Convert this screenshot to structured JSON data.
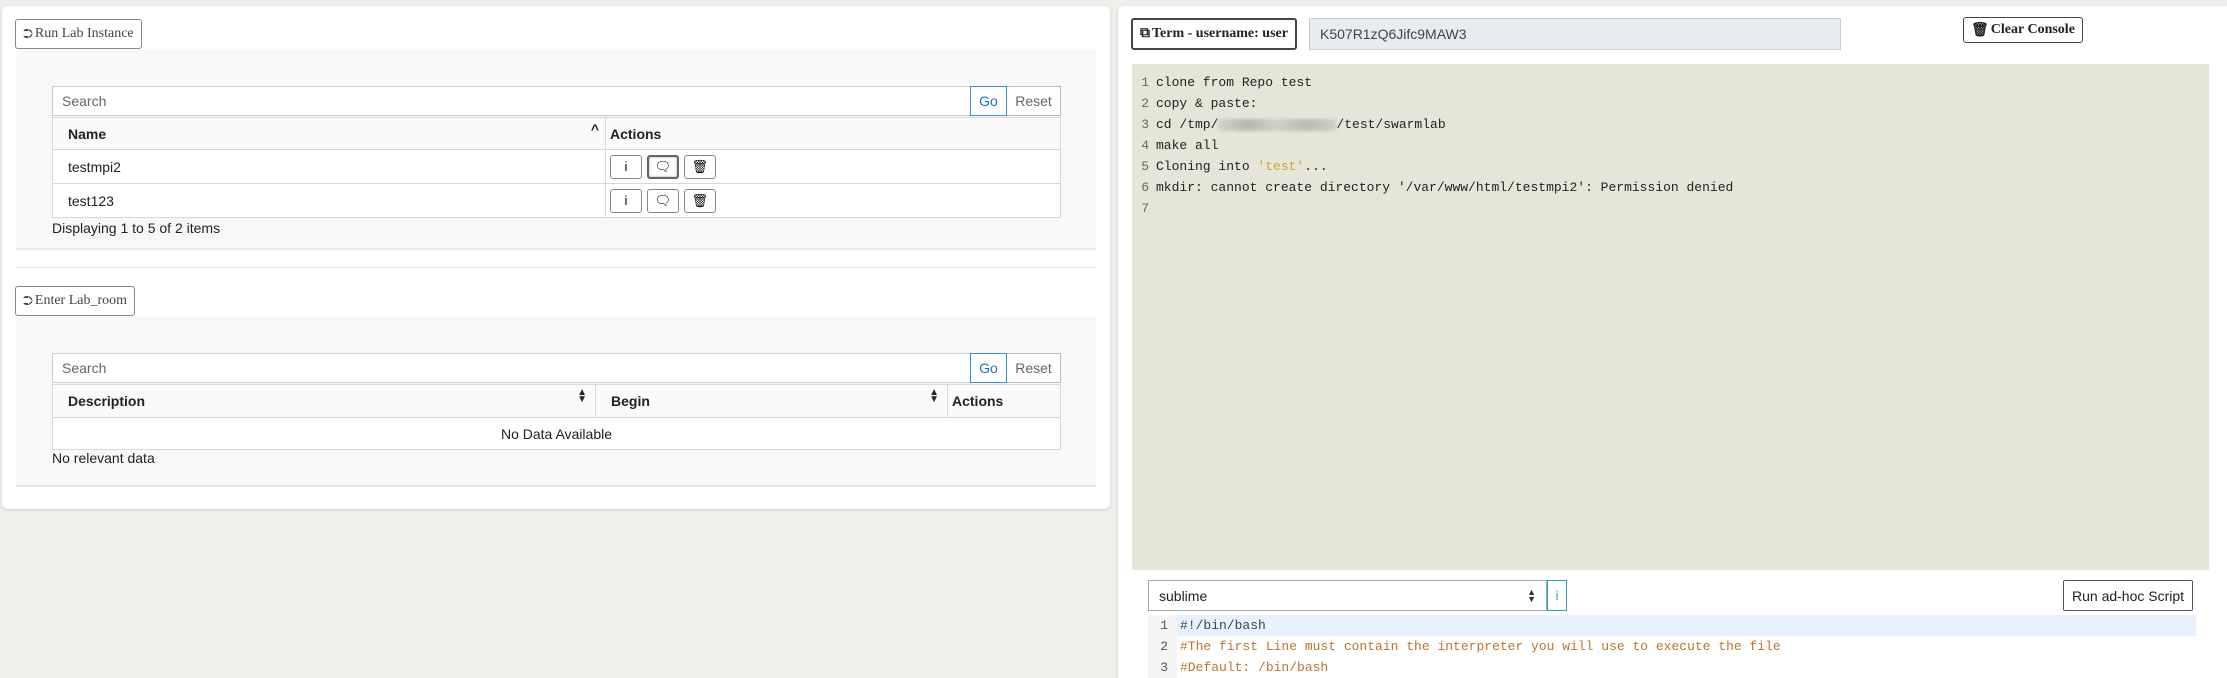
{
  "run_lab": {
    "legend": "Run Lab Instance",
    "search_placeholder": "Search",
    "go_label": "Go",
    "reset_label": "Reset",
    "columns": [
      "Name",
      "Actions"
    ],
    "rows": [
      {
        "name": "testmpi2"
      },
      {
        "name": "test123"
      }
    ],
    "action_icons": [
      "info-icon",
      "speech-bubble-icon",
      "trash-icon"
    ],
    "action_glyphs": {
      "info": "i",
      "chat": "🗨",
      "trash": "🗑"
    },
    "status": "Displaying 1 to 5 of 2 items"
  },
  "enter_lab": {
    "legend": "Enter Lab_room",
    "search_placeholder": "Search",
    "go_label": "Go",
    "reset_label": "Reset",
    "columns": [
      "Description",
      "Begin",
      "Actions"
    ],
    "empty_text": "No Data Available",
    "status": "No relevant data"
  },
  "terminal": {
    "term_label": "Term - username: user",
    "token": "K507R1zQ6Jifc9MAW3",
    "clear_label": "Clear Console",
    "lines": [
      {
        "n": "1",
        "text": "clone from Repo test"
      },
      {
        "n": "2",
        "text": "copy & paste:"
      },
      {
        "n": "3",
        "pre": "cd /tmp/",
        "post": "/test/swarmlab"
      },
      {
        "n": "4",
        "text": "make all"
      },
      {
        "n": "5",
        "pre": "Cloning into ",
        "hl": "'test'",
        "post": "..."
      },
      {
        "n": "6",
        "text": "mkdir: cannot create directory '/var/www/html/testmpi2': Permission denied"
      },
      {
        "n": "7",
        "text": ""
      }
    ]
  },
  "editor": {
    "theme": "sublime",
    "info_label": "i",
    "run_label": "Run ad-hoc Script",
    "lines": [
      {
        "n": "1",
        "text": "#!/bin/bash",
        "comment": false
      },
      {
        "n": "2",
        "text": "#The first Line must contain the interpreter you will use to execute the file",
        "comment": true
      },
      {
        "n": "3",
        "text": "#Default: /bin/bash",
        "comment": true
      }
    ]
  },
  "colors": {
    "accent": "#1a73c8",
    "console_bg": "#e5e6d8",
    "highlight": "#d4a12a",
    "info": "#27a0c4"
  }
}
